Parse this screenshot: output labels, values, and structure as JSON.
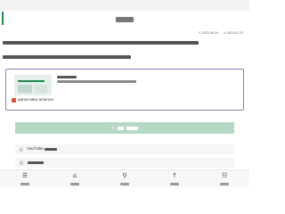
{
  "header": {
    "accent_color": "#1f8a4c"
  },
  "post": {
    "published_date": "2023.06.04",
    "updated_date": "2023.01.23"
  },
  "blog_card": {
    "site": "yama-taku.science"
  },
  "toc": {
    "bg_color": "#b6d9c6",
    "items": [
      {
        "num": "1.",
        "label": "YouTube"
      },
      {
        "num": "2.",
        "label": ""
      }
    ]
  },
  "bottom_nav": [
    {
      "icon": "menu-icon"
    },
    {
      "icon": "home-icon"
    },
    {
      "icon": "search-icon"
    },
    {
      "icon": "arrow-up-icon"
    },
    {
      "icon": "toc-icon"
    }
  ]
}
